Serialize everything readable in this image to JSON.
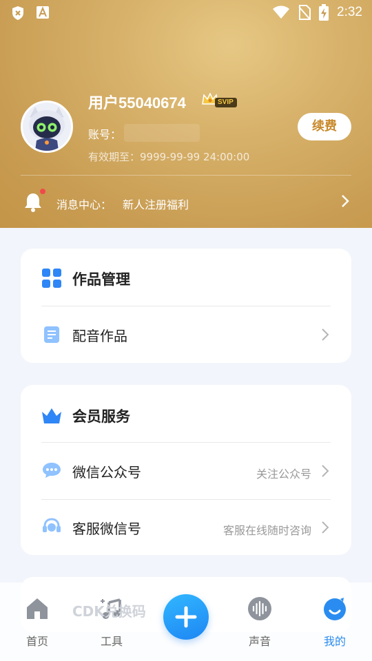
{
  "status_bar": {
    "time": "2:32",
    "icons": [
      "shield-x-icon",
      "font-a-icon",
      "wifi-icon",
      "no-sim-icon",
      "battery-charging-icon"
    ]
  },
  "profile": {
    "username": "用户55040674",
    "badge": "SVIP",
    "account_label": "账号：",
    "expiry": "有效期至：9999-99-99 24:00:00",
    "renew_label": "续费"
  },
  "message_center": {
    "label": "消息中心：",
    "text": "新人注册福利"
  },
  "works_card": {
    "title": "作品管理",
    "items": [
      {
        "label": "配音作品"
      }
    ]
  },
  "member_card": {
    "title": "会员服务",
    "items": [
      {
        "label": "微信公众号",
        "value": "关注公众号"
      },
      {
        "label": "客服微信号",
        "value": "客服在线随时咨询"
      }
    ]
  },
  "partial_card": {
    "label": "CDK兑换码"
  },
  "bottom_nav": {
    "items": [
      {
        "label": "首页",
        "icon": "home-icon"
      },
      {
        "label": "工具",
        "icon": "music-note-icon"
      },
      {
        "label": "",
        "icon": "plus-icon"
      },
      {
        "label": "声音",
        "icon": "voice-wave-icon"
      },
      {
        "label": "我的",
        "icon": "profile-face-icon"
      }
    ]
  },
  "colors": {
    "header_gold": "#d3ab63",
    "accent_blue": "#2a8cf0",
    "renew_text": "#c8892a"
  }
}
